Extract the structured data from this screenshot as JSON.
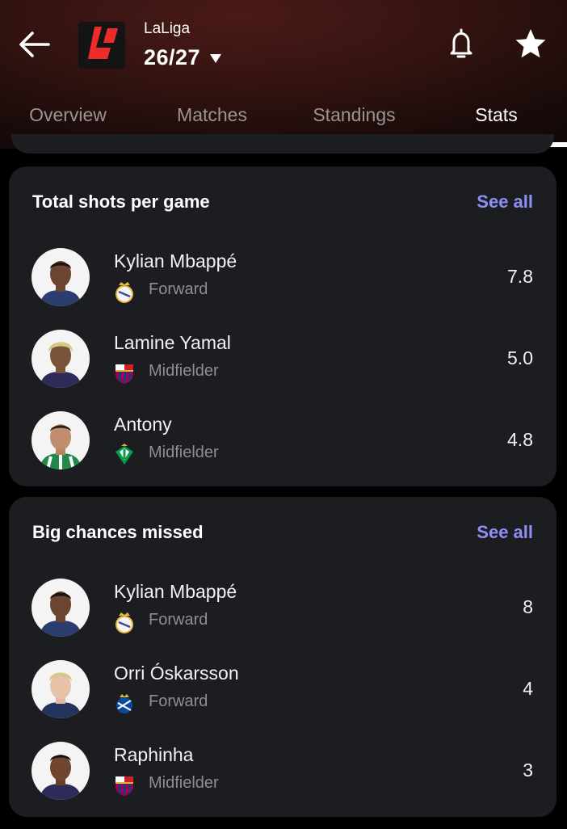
{
  "header": {
    "league_name": "LaLiga",
    "season": "26/27",
    "league_logo_color": "#ec2b2b"
  },
  "icons": {
    "back": "arrow-left-icon",
    "bell": "bell-icon",
    "star": "star-icon",
    "caret": "caret-down-icon"
  },
  "tabs": [
    {
      "label": "Overview",
      "active": false
    },
    {
      "label": "Matches",
      "active": false
    },
    {
      "label": "Standings",
      "active": false
    },
    {
      "label": "Stats",
      "active": true
    }
  ],
  "sections": [
    {
      "title": "Total shots per game",
      "see_all": "See all",
      "players": [
        {
          "name": "Kylian Mbappé",
          "position": "Forward",
          "club": "real-madrid-badge",
          "value": "7.8"
        },
        {
          "name": "Lamine Yamal",
          "position": "Midfielder",
          "club": "barcelona-badge",
          "value": "5.0"
        },
        {
          "name": "Antony",
          "position": "Midfielder",
          "club": "real-betis-badge",
          "value": "4.8"
        }
      ]
    },
    {
      "title": "Big chances missed",
      "see_all": "See all",
      "players": [
        {
          "name": "Kylian Mbappé",
          "position": "Forward",
          "club": "real-madrid-badge",
          "value": "8"
        },
        {
          "name": "Orri Óskarsson",
          "position": "Forward",
          "club": "real-sociedad-badge",
          "value": "4"
        },
        {
          "name": "Raphinha",
          "position": "Midfielder",
          "club": "barcelona-badge",
          "value": "3"
        }
      ]
    }
  ],
  "colors": {
    "accent": "#8f8ff5",
    "card_bg": "#1b1d21",
    "page_bg": "#000000",
    "secondary_text": "#8e8e93"
  }
}
